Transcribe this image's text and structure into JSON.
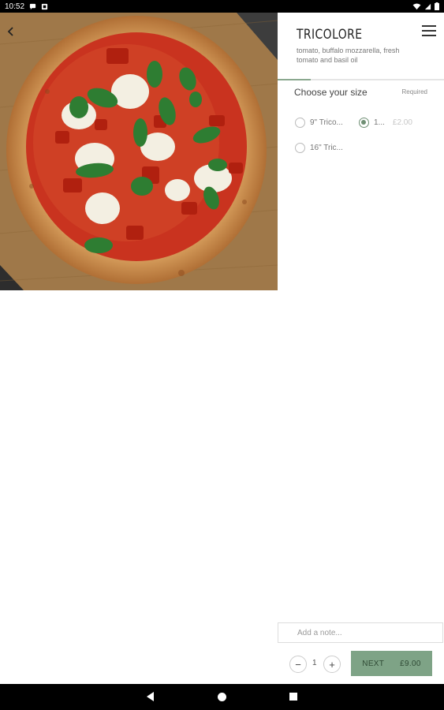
{
  "status_bar": {
    "time": "10:52",
    "icons": [
      "chat-bubble-icon",
      "notification-icon",
      "wifi-icon",
      "signal-icon",
      "battery-icon"
    ]
  },
  "product": {
    "title": "TRICOLORE",
    "description": "tomato, buffalo mozzarella, fresh tomato and basil oil",
    "progress_fraction": 0.2
  },
  "size_section": {
    "label": "Choose your size",
    "required_label": "Required",
    "options": [
      {
        "label": "9\" Trico...",
        "selected": false
      },
      {
        "label": "1...",
        "price": "£2.00",
        "selected": true
      },
      {
        "label": "16\" Tric...",
        "selected": false
      }
    ]
  },
  "note": {
    "placeholder": "Add a note..."
  },
  "quantity": {
    "value": "1",
    "minus_label": "−",
    "plus_label": "+"
  },
  "next_button": {
    "label": "NEXT",
    "price": "£9.00"
  },
  "colors": {
    "accent": "#7ea386",
    "radio_selected": "#6f8f74"
  }
}
